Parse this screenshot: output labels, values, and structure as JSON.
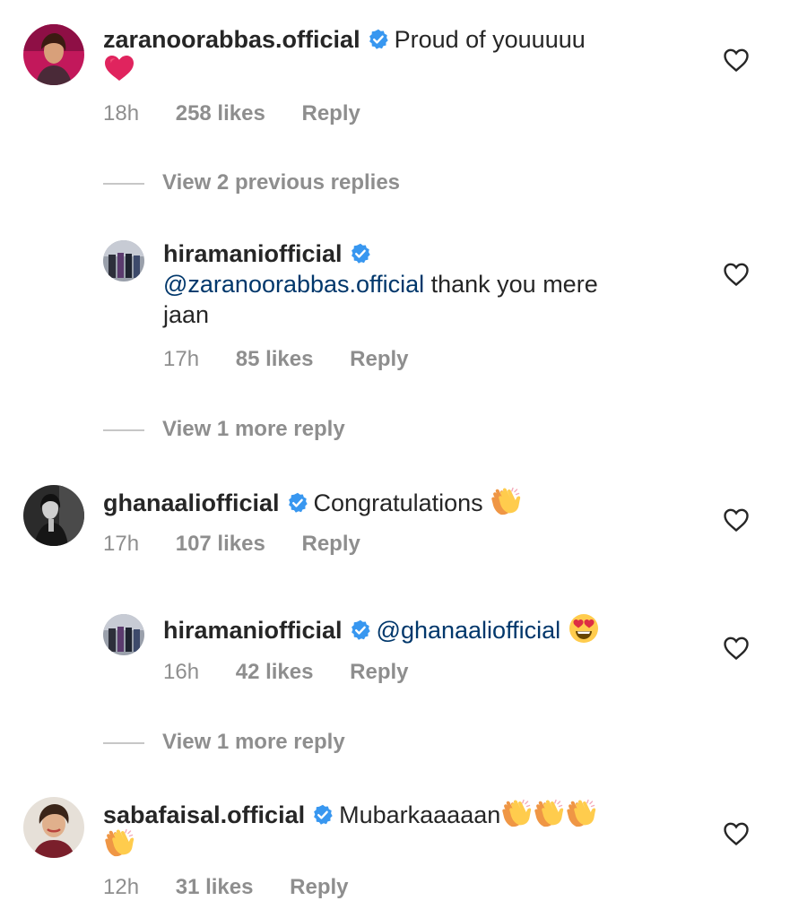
{
  "comments": [
    {
      "username": "zaranoorabbas.official",
      "text": "Proud of youuuuu",
      "emoji": "red-heart",
      "time": "18h",
      "likes": "258 likes",
      "reply": "Reply"
    },
    {
      "username": "hiramaniofficial",
      "mention": "@zaranoorabbas.official",
      "text": "thank you mere",
      "text2": "jaan",
      "time": "17h",
      "likes": "85 likes",
      "reply": "Reply"
    },
    {
      "username": "ghanaaliofficial",
      "text": "Congratulations",
      "emoji": "clapping-hands",
      "time": "17h",
      "likes": "107 likes",
      "reply": "Reply"
    },
    {
      "username": "hiramaniofficial",
      "mention": "@ghanaaliofficial",
      "emoji": "heart-eyes",
      "time": "16h",
      "likes": "42 likes",
      "reply": "Reply"
    },
    {
      "username": "sabafaisal.official",
      "text": "Mubarkaaaaan",
      "emoji": "clapping-hands",
      "time": "12h",
      "likes": "31 likes",
      "reply": "Reply"
    }
  ],
  "view_links": {
    "previous": "View 2 previous replies",
    "more1": "View 1 more reply",
    "more2": "View 1 more reply"
  },
  "colors": {
    "text": "#262626",
    "muted": "#8e8e8e",
    "mention": "#00376b",
    "verified": "#3897f0"
  }
}
